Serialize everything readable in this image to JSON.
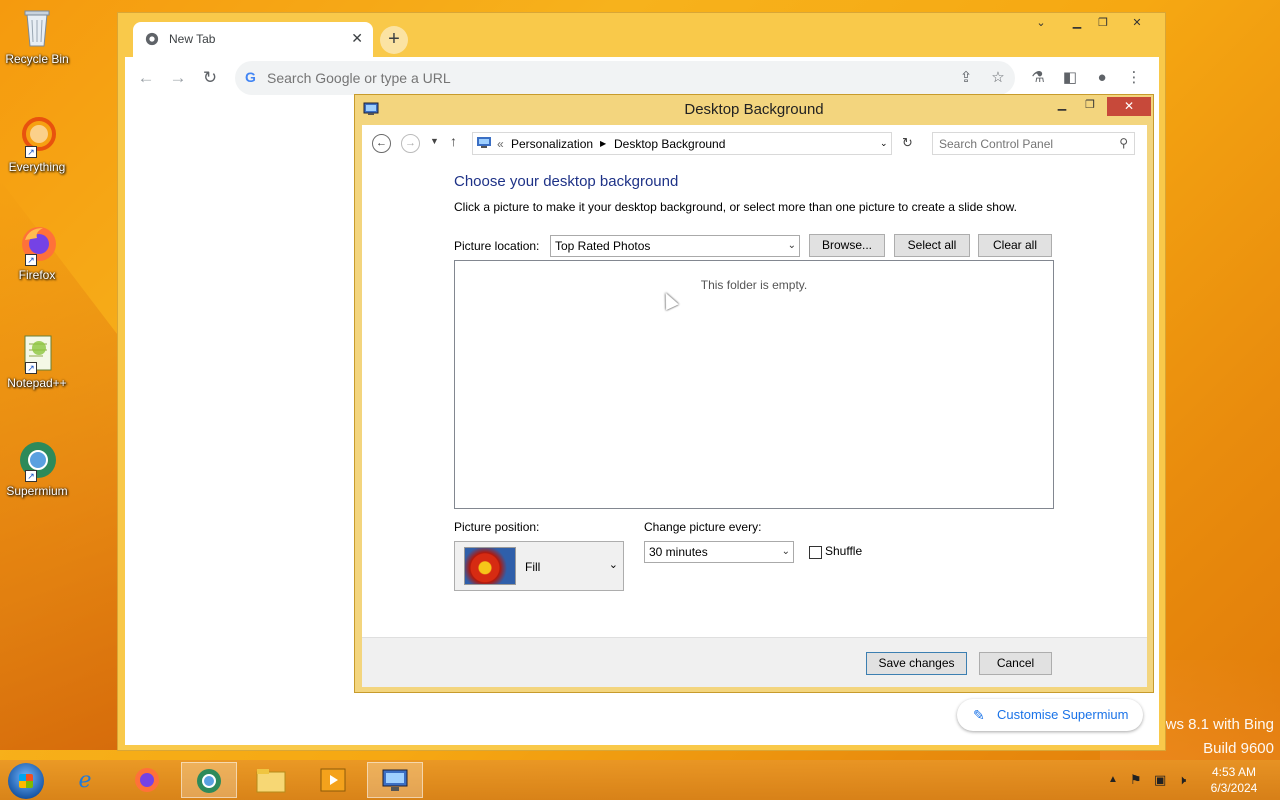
{
  "desktop": {
    "icons": [
      {
        "label": "Recycle Bin",
        "icon": "recycle-bin-icon"
      },
      {
        "label": "Everything",
        "icon": "everything-icon"
      },
      {
        "label": "Firefox",
        "icon": "firefox-icon"
      },
      {
        "label": "Notepad++",
        "icon": "notepadpp-icon"
      },
      {
        "label": "Supermium",
        "icon": "supermium-icon"
      }
    ],
    "watermark_line1": "ws 8.1 with Bing",
    "watermark_line2": "Build 9600"
  },
  "browser": {
    "tab_title": "New Tab",
    "tab_close": "✕",
    "new_tab": "+",
    "omnibox_placeholder": "Search Google or type a URL",
    "customise_label": "Customise Supermium"
  },
  "dialog": {
    "title": "Desktop Background",
    "breadcrumb": {
      "prefix": "«",
      "items": [
        "Personalization",
        "Desktop Background"
      ]
    },
    "search_placeholder": "Search Control Panel",
    "heading": "Choose your desktop background",
    "description": "Click a picture to make it your desktop background, or select more than one picture to create a slide show.",
    "picture_location_label": "Picture location:",
    "picture_location_value": "Top Rated Photos",
    "browse_label": "Browse...",
    "select_all_label": "Select all",
    "clear_all_label": "Clear all",
    "empty_message": "This folder is empty.",
    "picture_position_label": "Picture position:",
    "picture_position_value": "Fill",
    "change_every_label": "Change picture every:",
    "change_every_value": "30 minutes",
    "shuffle_label": "Shuffle",
    "shuffle_checked": false,
    "save_label": "Save changes",
    "cancel_label": "Cancel"
  },
  "taskbar": {
    "items": [
      "internet-explorer-icon",
      "firefox-icon",
      "supermium-icon",
      "file-explorer-icon",
      "media-player-icon",
      "control-panel-icon"
    ],
    "active_item": "control-panel-icon",
    "time": "4:53 AM",
    "date": "6/3/2024"
  }
}
